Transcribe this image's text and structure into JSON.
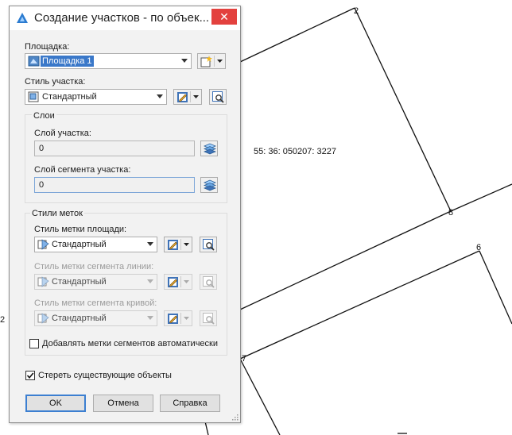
{
  "drawing": {
    "parcel_label": "55: 36: 050207: 3227",
    "vertex_labels": [
      "2",
      "8",
      "6",
      "7",
      "2"
    ]
  },
  "dialog": {
    "title": "Создание участков - по объек...",
    "close_symbol": "✕",
    "site": {
      "label": "Площадка:",
      "value": "Площадка 1"
    },
    "parcel_style": {
      "label": "Стиль участка:",
      "value": "Стандартный"
    },
    "layers": {
      "group_label": "Слои",
      "parcel_layer_label": "Слой участка:",
      "parcel_layer_value": "0",
      "segment_layer_label": "Слой сегмента участка:",
      "segment_layer_value": "0"
    },
    "label_styles": {
      "group_label": "Стили меток",
      "area_label": "Стиль метки площади:",
      "area_value": "Стандартный",
      "line_label": "Стиль метки сегмента линии:",
      "line_value": "Стандартный",
      "curve_label": "Стиль метки сегмента кривой:",
      "curve_value": "Стандартный",
      "auto_add_label": "Добавлять метки сегментов автоматически",
      "auto_add_checked": false
    },
    "erase_existing": {
      "label": "Стереть существующие объекты",
      "checked": true
    },
    "buttons": {
      "ok": "OK",
      "cancel": "Отмена",
      "help": "Справка"
    }
  }
}
